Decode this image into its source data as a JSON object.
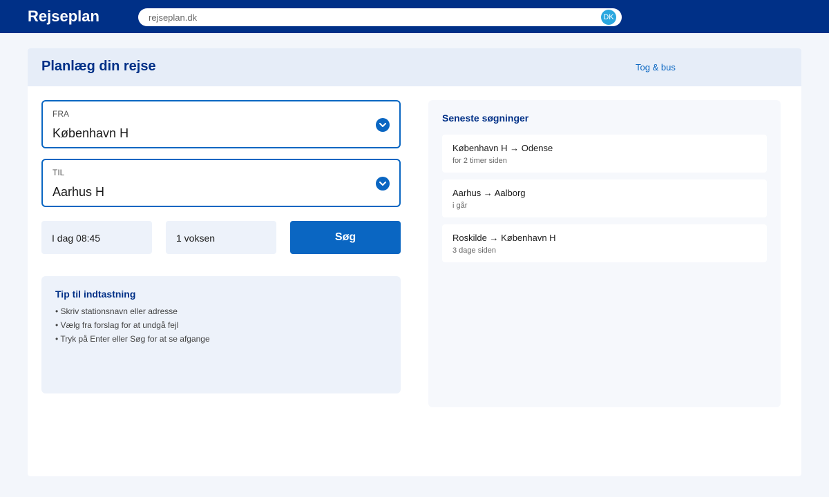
{
  "topbar": {
    "brand": "Rejseplan",
    "url": "rejseplan.dk",
    "locale_badge": "DK",
    "colors": {
      "bar": "#003087",
      "badge": "#2aa7df"
    }
  },
  "header": {
    "title": "Planlæg din rejse",
    "mode_link": "Tog & bus"
  },
  "form": {
    "from": {
      "label": "FRA",
      "value": "København H",
      "icon": "chevron-down-icon"
    },
    "to": {
      "label": "TIL",
      "value": "Aarhus H",
      "icon": "chevron-down-icon"
    },
    "datetime": "I dag 08:45",
    "passengers": "1 voksen",
    "search_label": "Søg",
    "colors": {
      "accent": "#0a66c2"
    }
  },
  "tips": {
    "title": "Tip til indtastning",
    "items": [
      "• Skriv stationsnavn eller adresse",
      "• Vælg fra forslag for at undgå fejl",
      "• Tryk på Enter eller Søg for at se afgange"
    ]
  },
  "recent": {
    "title": "Seneste søgninger",
    "items": [
      {
        "route": "København H → Odense",
        "time": "for 2 timer siden"
      },
      {
        "route": "Aarhus → Aalborg",
        "time": "i går"
      },
      {
        "route": "Roskilde → København H",
        "time": "3 dage siden"
      }
    ]
  }
}
